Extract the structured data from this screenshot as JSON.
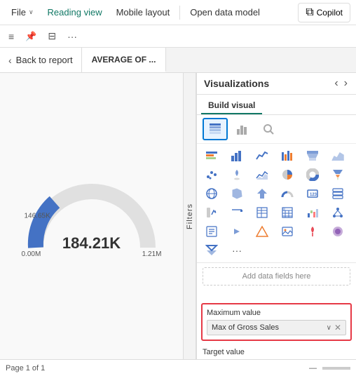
{
  "menubar": {
    "file_label": "File",
    "reading_view_label": "Reading view",
    "mobile_layout_label": "Mobile layout",
    "open_data_model_label": "Open data model",
    "copilot_label": "Copilot"
  },
  "toolbar": {
    "icons": [
      "≡",
      "📌",
      "≡",
      "···"
    ]
  },
  "tabs": {
    "back_label": "Back to report",
    "active_tab_label": "AVERAGE OF ..."
  },
  "filters": {
    "label": "Filters"
  },
  "gauge": {
    "value": "184.21K",
    "min": "0.00M",
    "max": "1.21M",
    "side_label": "146.65K"
  },
  "viz_panel": {
    "title": "Visualizations",
    "nav_left": "‹",
    "nav_right": "›",
    "build_visual_label": "Build visual",
    "add_data_hint": "Add data fields here"
  },
  "max_value": {
    "label": "Maximum value",
    "field": "Max of Gross Sales"
  },
  "target_value": {
    "label": "Target value"
  },
  "status_bar": {
    "page_label": "Page 1 of 1"
  }
}
